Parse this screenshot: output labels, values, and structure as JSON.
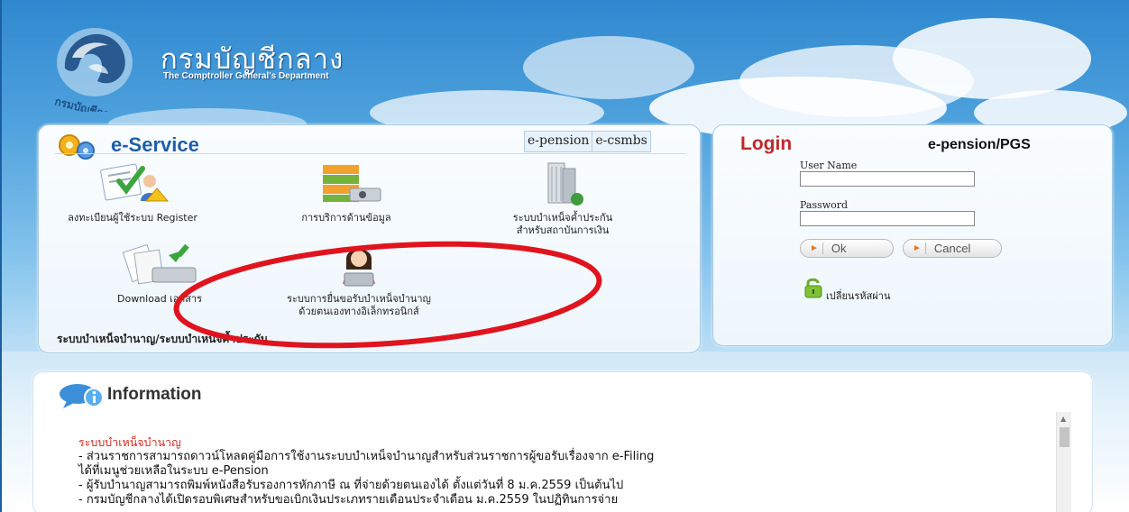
{
  "header": {
    "title_thai": "กรมบัญชีกลาง",
    "title_en": "The Comptroller General's Department",
    "seal_text": "กรมบัญชีกลาง"
  },
  "eservice": {
    "title": "e-Service",
    "tabs": [
      "e-pension",
      "e-csmbs"
    ],
    "items": [
      {
        "label_line1": "ลงทะเบียนผู้ใช้ระบบ Register",
        "label_line2": "",
        "icon": "register-icon"
      },
      {
        "label_line1": "การบริการด้านข้อมูล",
        "label_line2": "",
        "icon": "database-icon"
      },
      {
        "label_line1": "ระบบบำเหน็จค้ำประกัน",
        "label_line2": "สำหรับสถาบันการเงิน",
        "icon": "building-icon"
      },
      {
        "label_line1": "Download เอกสาร",
        "label_line2": "",
        "icon": "download-icon"
      },
      {
        "label_line1": "ระบบการยื่นขอรับบำเหน็จบำนาญ",
        "label_line2": "ด้วยตนเองทางอิเล็กทรอนิกส์",
        "icon": "person-computer-icon"
      }
    ],
    "footer": "ระบบบำเหน็จบำนาญ/ระบบบำเหน็จค้ำประกัน"
  },
  "login": {
    "title": "Login",
    "subtitle": "e-pension/PGS",
    "username_label": "User Name",
    "password_label": "Password",
    "username_value": "",
    "password_value": "",
    "ok_label": "Ok",
    "cancel_label": "Cancel",
    "change_password": "เปลี่ยนรหัสผ่าน"
  },
  "info": {
    "title": "Information",
    "heading": "ระบบบำเหน็จบำนาญ",
    "lines": [
      "- ส่วนราชการสามารถดาวน์โหลดคู่มือการใช้งานระบบบำเหน็จบำนาญสำหรับส่วนราชการผู้ขอรับเรื่องจาก e-Filing",
      "ได้ที่เมนูช่วยเหลือในระบบ e-Pension",
      "- ผู้รับบำนาญสามารถพิมพ์หนังสือรับรองการหักภาษี ณ ที่จ่ายด้วยตนเองได้ ตั้งแต่วันที่ 8 ม.ค.2559 เป็นต้นไป",
      "- กรมบัญชีกลางได้เปิดรอบพิเศษสำหรับขอเบิกเงินประเภทรายเดือนประจำเดือน ม.ค.2559 ในปฏิทินการจ่าย"
    ]
  },
  "colors": {
    "login_title": "#c0282a",
    "eservice_title": "#1f5ea8",
    "info_heading": "#d12a1f",
    "annotation_ellipse": "#e0141e"
  }
}
